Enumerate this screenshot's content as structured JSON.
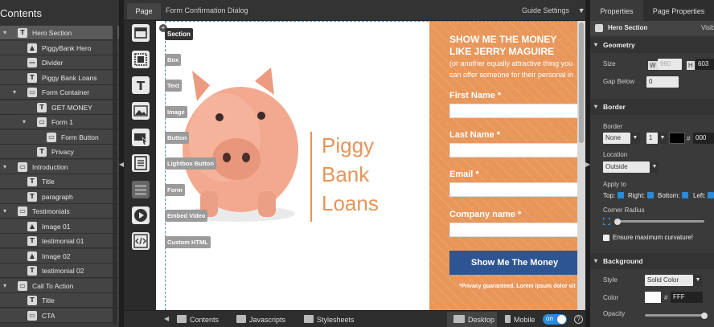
{
  "tree": {
    "header": "Contents",
    "items": [
      {
        "label": "Hero Section",
        "icon": "T",
        "depth": 0,
        "toggle": "▾",
        "selected": true
      },
      {
        "label": "PiggyBank Hero",
        "icon": "▲",
        "depth": 1
      },
      {
        "label": "Divider",
        "icon": "—",
        "depth": 1
      },
      {
        "label": "Piggy Bank Loans",
        "icon": "T",
        "depth": 1
      },
      {
        "label": "Form Container",
        "icon": "▭",
        "depth": 1,
        "toggle": "▾"
      },
      {
        "label": "GET MONEY",
        "icon": "T",
        "depth": 2
      },
      {
        "label": "Form 1",
        "icon": "▭",
        "depth": 2,
        "toggle": "▾"
      },
      {
        "label": "Form Button",
        "icon": "▭",
        "depth": 3
      },
      {
        "label": "Privacy",
        "icon": "T",
        "depth": 2
      },
      {
        "label": "Introduction",
        "icon": "▭",
        "depth": 0,
        "toggle": "▾"
      },
      {
        "label": "Title",
        "icon": "T",
        "depth": 1
      },
      {
        "label": "paragraph",
        "icon": "T",
        "depth": 1
      },
      {
        "label": "Testimonials",
        "icon": "▭",
        "depth": 0,
        "toggle": "▾"
      },
      {
        "label": "Image 01",
        "icon": "▲",
        "depth": 1
      },
      {
        "label": "testimonial 01",
        "icon": "T",
        "depth": 1
      },
      {
        "label": "Image 02",
        "icon": "▲",
        "depth": 1
      },
      {
        "label": "testimonial 02",
        "icon": "T",
        "depth": 1
      },
      {
        "label": "Call To Action",
        "icon": "▭",
        "depth": 0,
        "toggle": "▾"
      },
      {
        "label": "Title",
        "icon": "T",
        "depth": 1
      },
      {
        "label": "CTA",
        "icon": "▭",
        "depth": 1
      }
    ]
  },
  "topbar": {
    "page_tab": "Page",
    "dialog_title": "Form Confirmation Dialog",
    "guide_settings": "Guide Settings"
  },
  "tools": [
    {
      "name": "section-tool",
      "chip": "Section",
      "icon": "section-icon"
    },
    {
      "name": "box-tool",
      "chip": "Box",
      "icon": "box-icon"
    },
    {
      "name": "text-tool",
      "chip": "Text",
      "icon": "text-icon"
    },
    {
      "name": "image-tool",
      "chip": "Image",
      "icon": "image-icon"
    },
    {
      "name": "button-tool",
      "chip": "Button",
      "icon": "button-icon"
    },
    {
      "name": "lightbox-button-tool",
      "chip": "Lightbox Button",
      "icon": "lightbox-icon"
    },
    {
      "name": "form-tool",
      "chip": "Form",
      "icon": "form-icon"
    },
    {
      "name": "embed-video-tool",
      "chip": "Embed Video",
      "icon": "play-icon"
    },
    {
      "name": "custom-html-tool",
      "chip": "Custom HTML",
      "icon": "code-icon"
    }
  ],
  "hero": {
    "brand_lines": [
      "Piggy",
      "Bank",
      "Loans"
    ],
    "form": {
      "title_line1": "SHOW ME THE MONEY",
      "title_line2": "LIKE JERRY MAGUIRE",
      "sub_line1": "(or another equally attractive thing you",
      "sub_line2": "can offer someone for their personal in",
      "fields": [
        {
          "label": "First Name *"
        },
        {
          "label": "Last Name *"
        },
        {
          "label": "Email *"
        },
        {
          "label": "Company name *"
        }
      ],
      "submit": "Show Me The Money",
      "privacy": "*Privacy guaranteed. Lorem ipsum dolor sit"
    }
  },
  "bottombar": {
    "contents": "Contents",
    "javascripts": "Javascripts",
    "stylesheets": "Stylesheets",
    "desktop": "Desktop",
    "mobile": "Mobile",
    "toggle_label": "on",
    "help": "?"
  },
  "props": {
    "tab_properties": "Properties",
    "tab_page": "Page Properties",
    "element_name": "Hero Section",
    "element_vis": "Visib",
    "geometry": {
      "header": "Geometry",
      "size_label": "Size",
      "w_label": "W",
      "w_value": "960",
      "h_label": "H",
      "h_value": "603",
      "gap_label": "Gap Below",
      "gap_value": "0"
    },
    "border": {
      "header": "Border",
      "border_label": "Border",
      "style_value": "None",
      "width_value": "1",
      "hash": "#",
      "color_value": "000",
      "location_label": "Location",
      "location_value": "Outside",
      "apply_label": "Apply to",
      "top": "Top:",
      "right": "Right:",
      "bottom": "Bottom:",
      "left": "Left:",
      "corner_label": "Corner Radius",
      "max_curve": "Ensure maximum curvature!"
    },
    "background": {
      "header": "Background",
      "style_label": "Style",
      "style_value": "Solid Color",
      "color_label": "Color",
      "hash": "#",
      "color_value": "FFF",
      "opacity_label": "Opacity"
    }
  }
}
